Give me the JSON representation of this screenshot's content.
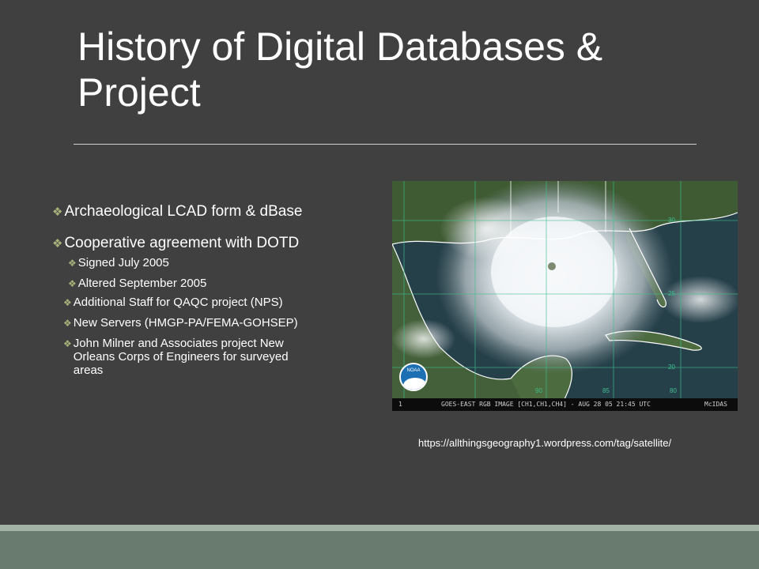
{
  "slide": {
    "title": "History of Digital Databases & Project",
    "bullets": [
      {
        "text": "Archaeological LCAD form & dBase"
      },
      {
        "text": "Cooperative agreement with DOTD",
        "sub": [
          "Signed July 2005",
          "Altered September 2005",
          "Additional Staff for QAQC project (NPS)",
          "New Servers (HMGP-PA/FEMA-GOHSEP)",
          "John Milner and Associates project New Orleans Corps of Engineers for surveyed areas"
        ]
      }
    ],
    "image": {
      "banner_text": "GOES-EAST RGB IMAGE [CH1,CH1,CH4] - AUG 28 05 21:45 UTC",
      "banner_left": "1",
      "banner_right": "McIDAS",
      "logo_text": "NOAA",
      "grid_labels": [
        "30",
        "25",
        "20",
        "90",
        "85",
        "80"
      ]
    },
    "caption": "https://allthingsgeography1.wordpress.com/tag/satellite/",
    "colors": {
      "background": "#404040",
      "bullet": "#a7b37a",
      "band_light": "#a3b3a5",
      "band_dark": "#697b6e"
    }
  }
}
